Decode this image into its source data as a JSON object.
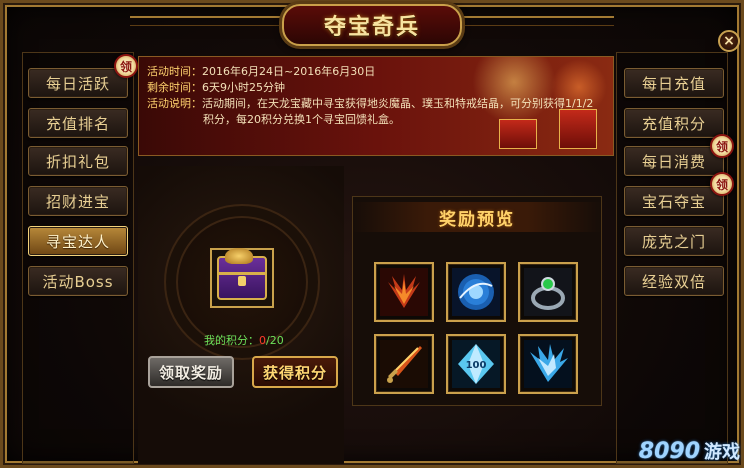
{
  "title": "夺宝奇兵",
  "close_label": "×",
  "badge_label": "领",
  "left_menu": [
    {
      "label": "每日活跃",
      "active": false,
      "badge": true
    },
    {
      "label": "充值排名",
      "active": false,
      "badge": false
    },
    {
      "label": "折扣礼包",
      "active": false,
      "badge": false
    },
    {
      "label": "招财进宝",
      "active": false,
      "badge": false
    },
    {
      "label": "寻宝达人",
      "active": true,
      "badge": false
    },
    {
      "label": "活动Boss",
      "active": false,
      "badge": false
    }
  ],
  "right_menu": [
    {
      "label": "每日充值",
      "badge": false
    },
    {
      "label": "充值积分",
      "badge": false
    },
    {
      "label": "每日消费",
      "badge": true
    },
    {
      "label": "宝石夺宝",
      "badge": true
    },
    {
      "label": "庞克之门",
      "badge": false
    },
    {
      "label": "经验双倍",
      "badge": false
    }
  ],
  "info": {
    "time_label": "活动时间：",
    "time_value": "2016年6月24日~2016年6月30日",
    "remain_label": "剩余时间：",
    "remain_value": "6天9小时25分钟",
    "desc_label": "活动说明：",
    "desc_line1": "活动期间，在天龙宝藏中寻宝获得地炎魔晶、璞玉和特戒结晶，可分别获得1/1/2",
    "desc_line2": "积分，每20积分兑换1个寻宝回馈礼盒。"
  },
  "points": {
    "label": "我的积分：",
    "current": "0",
    "sep": "/",
    "total": "20"
  },
  "buttons": {
    "claim": "领取奖励",
    "earn": "获得积分"
  },
  "rewards": {
    "title": "奖励预览",
    "items": [
      {
        "icon": "flame-wings-icon",
        "color": "#c43a18"
      },
      {
        "icon": "blue-orb-icon",
        "color": "#2a7fd8"
      },
      {
        "icon": "green-gem-ring-icon",
        "color": "#9aa8b4"
      },
      {
        "icon": "fire-sword-icon",
        "color": "#d8541a"
      },
      {
        "icon": "crystal-100-icon",
        "color": "#5ac8f0",
        "text": "100"
      },
      {
        "icon": "ice-wings-icon",
        "color": "#3aa8e8"
      }
    ]
  },
  "watermark": {
    "brand": "8090",
    "name": "游戏"
  }
}
